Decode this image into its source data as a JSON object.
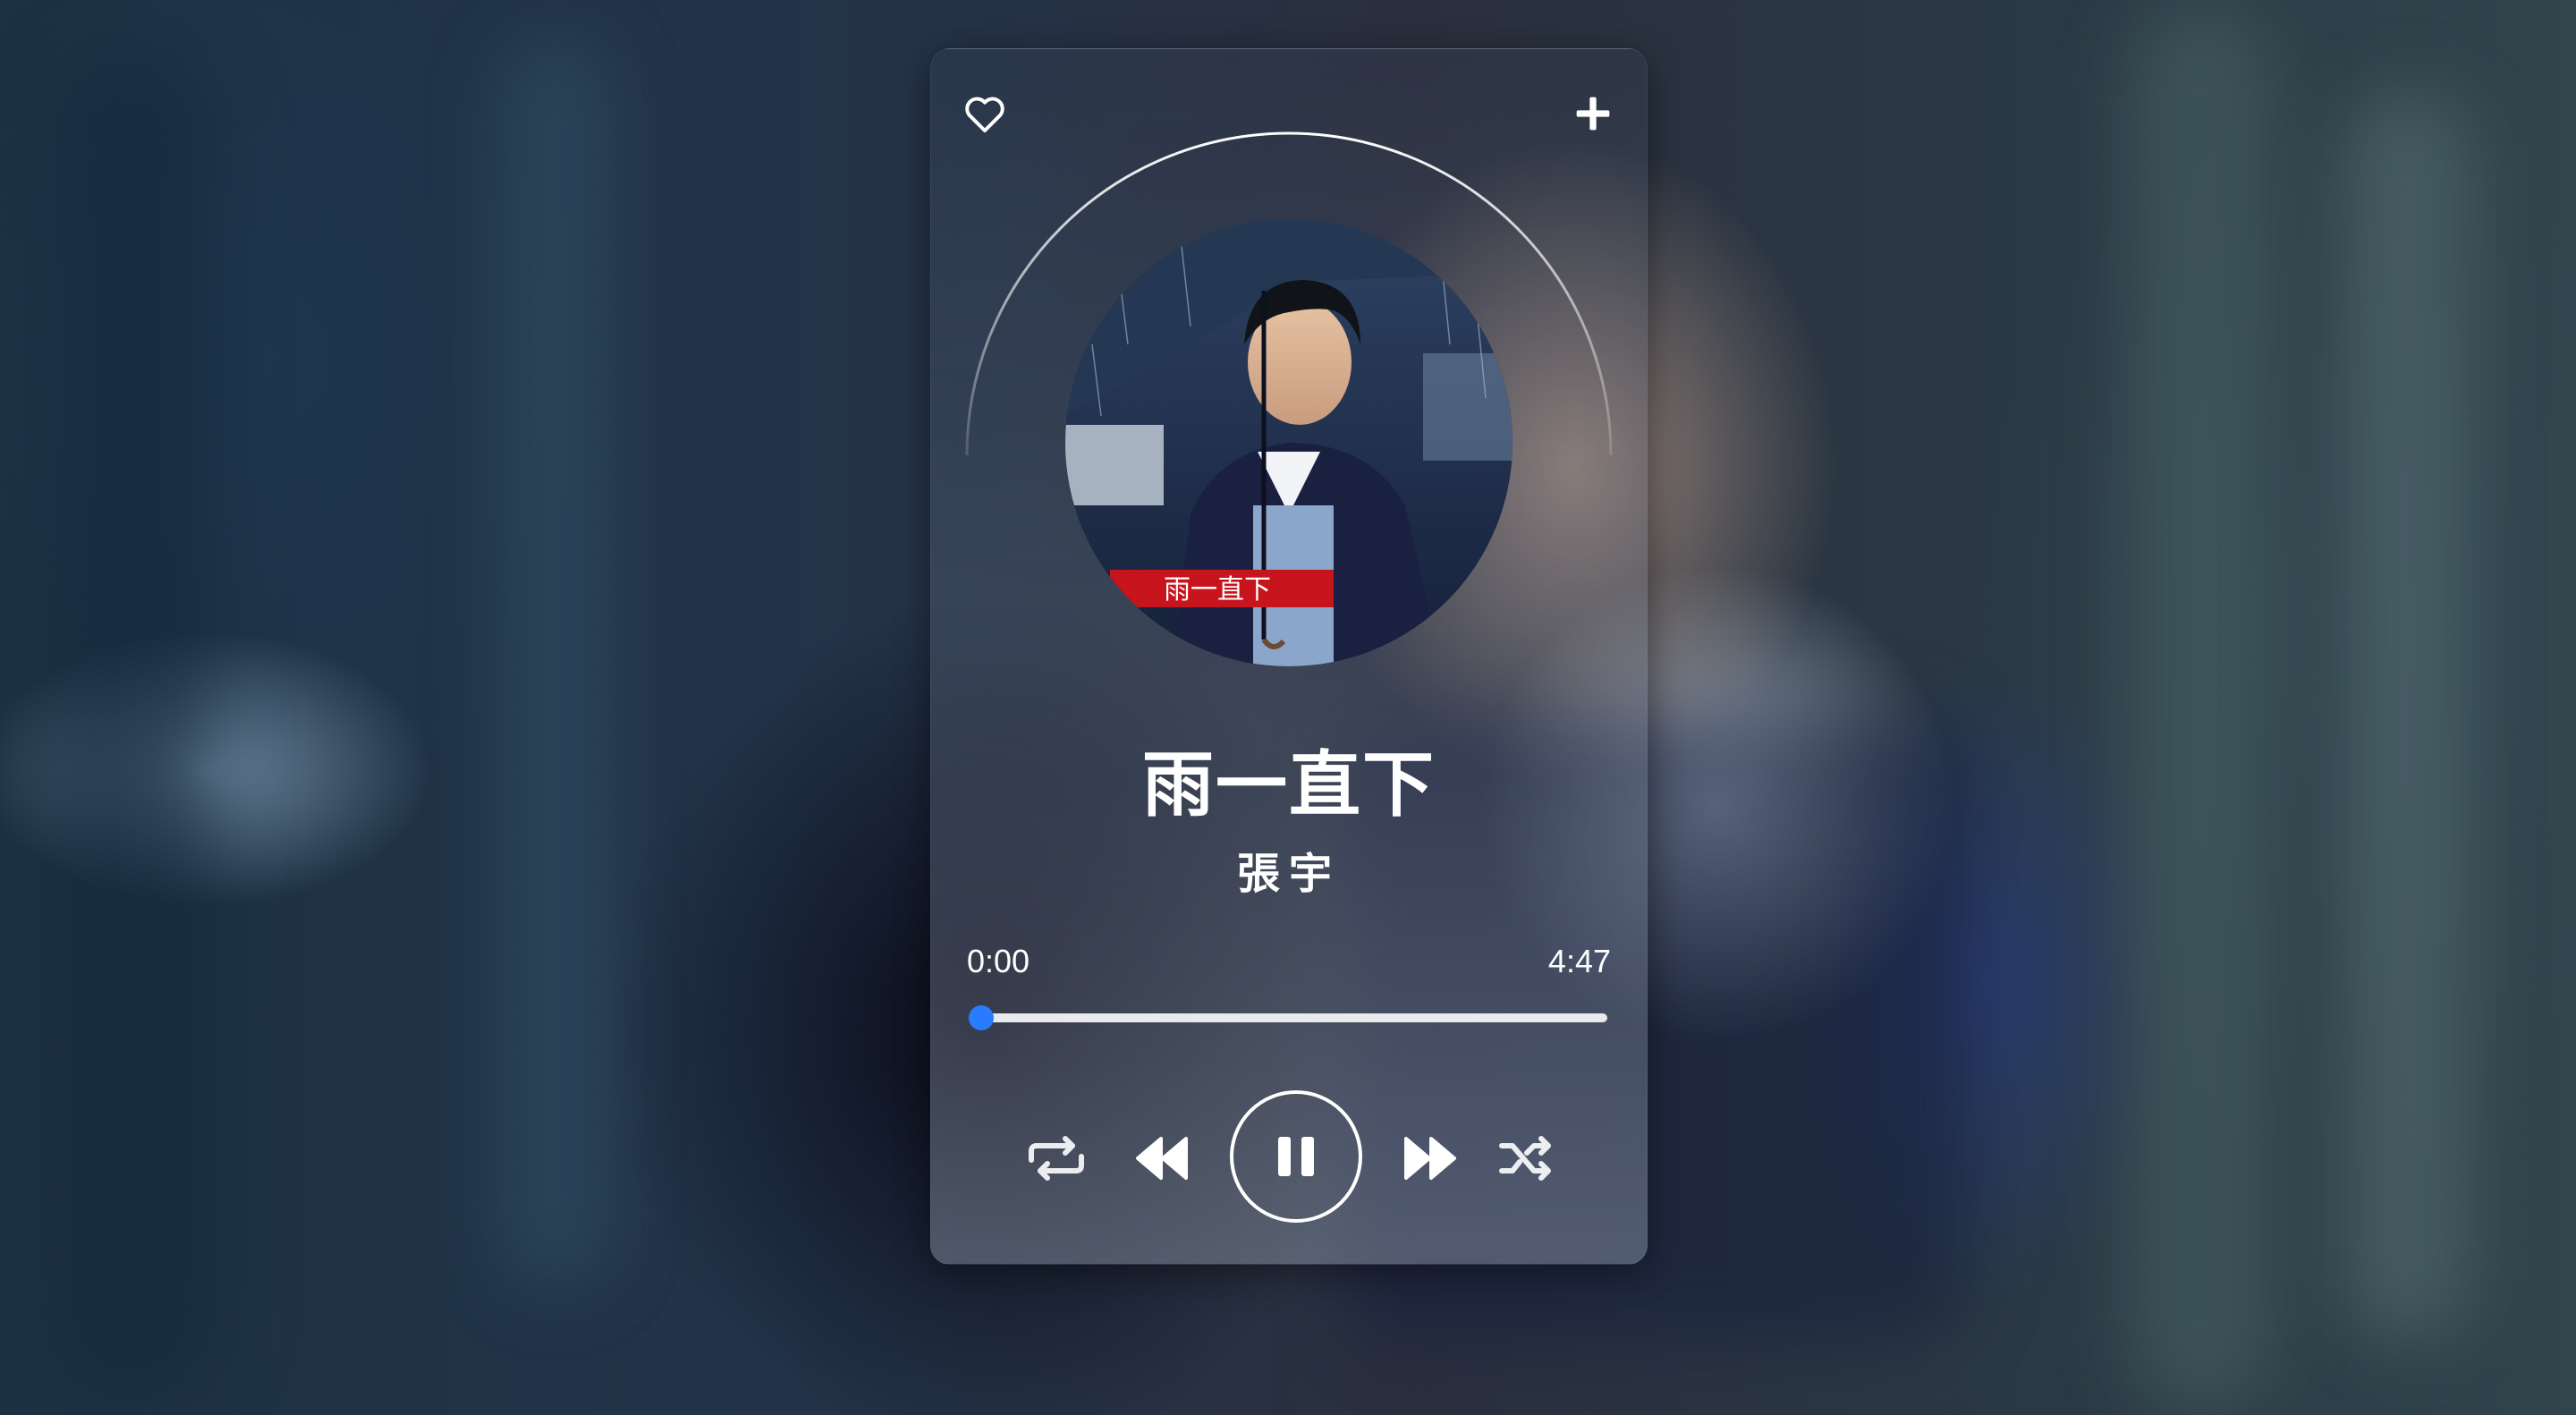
{
  "player": {
    "song_title": "雨一直下",
    "artist": "張宇",
    "current_time": "0:00",
    "total_time": "4:47",
    "progress": 0.0,
    "album_banner_text": "雨一直下",
    "accent_color": "#2b7bff",
    "icons": {
      "favorite": "heart-icon",
      "add": "plus-icon",
      "repeat": "repeat-icon",
      "previous": "rewind-icon",
      "pause": "pause-icon",
      "next": "fast-forward-icon",
      "shuffle": "shuffle-icon"
    }
  }
}
